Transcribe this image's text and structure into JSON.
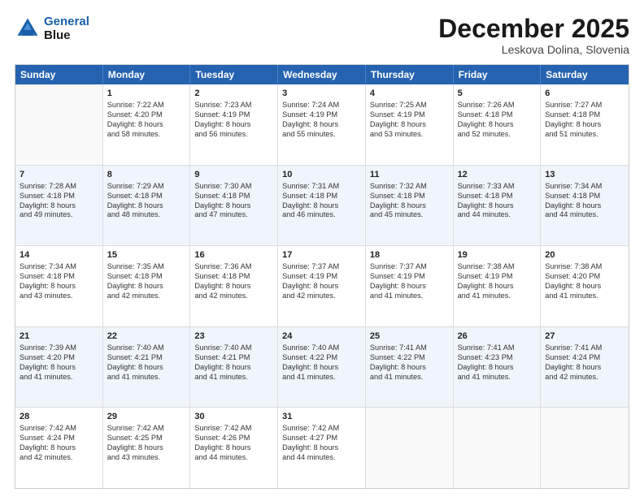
{
  "header": {
    "logo_line1": "General",
    "logo_line2": "Blue",
    "month": "December 2025",
    "location": "Leskova Dolina, Slovenia"
  },
  "days_of_week": [
    "Sunday",
    "Monday",
    "Tuesday",
    "Wednesday",
    "Thursday",
    "Friday",
    "Saturday"
  ],
  "rows": [
    [
      {
        "day": "",
        "sunrise": "",
        "sunset": "",
        "daylight": "",
        "empty": true
      },
      {
        "day": "1",
        "sunrise": "Sunrise: 7:22 AM",
        "sunset": "Sunset: 4:20 PM",
        "daylight": "Daylight: 8 hours",
        "daylight2": "and 58 minutes."
      },
      {
        "day": "2",
        "sunrise": "Sunrise: 7:23 AM",
        "sunset": "Sunset: 4:19 PM",
        "daylight": "Daylight: 8 hours",
        "daylight2": "and 56 minutes."
      },
      {
        "day": "3",
        "sunrise": "Sunrise: 7:24 AM",
        "sunset": "Sunset: 4:19 PM",
        "daylight": "Daylight: 8 hours",
        "daylight2": "and 55 minutes."
      },
      {
        "day": "4",
        "sunrise": "Sunrise: 7:25 AM",
        "sunset": "Sunset: 4:19 PM",
        "daylight": "Daylight: 8 hours",
        "daylight2": "and 53 minutes."
      },
      {
        "day": "5",
        "sunrise": "Sunrise: 7:26 AM",
        "sunset": "Sunset: 4:18 PM",
        "daylight": "Daylight: 8 hours",
        "daylight2": "and 52 minutes."
      },
      {
        "day": "6",
        "sunrise": "Sunrise: 7:27 AM",
        "sunset": "Sunset: 4:18 PM",
        "daylight": "Daylight: 8 hours",
        "daylight2": "and 51 minutes."
      }
    ],
    [
      {
        "day": "7",
        "sunrise": "Sunrise: 7:28 AM",
        "sunset": "Sunset: 4:18 PM",
        "daylight": "Daylight: 8 hours",
        "daylight2": "and 49 minutes."
      },
      {
        "day": "8",
        "sunrise": "Sunrise: 7:29 AM",
        "sunset": "Sunset: 4:18 PM",
        "daylight": "Daylight: 8 hours",
        "daylight2": "and 48 minutes."
      },
      {
        "day": "9",
        "sunrise": "Sunrise: 7:30 AM",
        "sunset": "Sunset: 4:18 PM",
        "daylight": "Daylight: 8 hours",
        "daylight2": "and 47 minutes."
      },
      {
        "day": "10",
        "sunrise": "Sunrise: 7:31 AM",
        "sunset": "Sunset: 4:18 PM",
        "daylight": "Daylight: 8 hours",
        "daylight2": "and 46 minutes."
      },
      {
        "day": "11",
        "sunrise": "Sunrise: 7:32 AM",
        "sunset": "Sunset: 4:18 PM",
        "daylight": "Daylight: 8 hours",
        "daylight2": "and 45 minutes."
      },
      {
        "day": "12",
        "sunrise": "Sunrise: 7:33 AM",
        "sunset": "Sunset: 4:18 PM",
        "daylight": "Daylight: 8 hours",
        "daylight2": "and 44 minutes."
      },
      {
        "day": "13",
        "sunrise": "Sunrise: 7:34 AM",
        "sunset": "Sunset: 4:18 PM",
        "daylight": "Daylight: 8 hours",
        "daylight2": "and 44 minutes."
      }
    ],
    [
      {
        "day": "14",
        "sunrise": "Sunrise: 7:34 AM",
        "sunset": "Sunset: 4:18 PM",
        "daylight": "Daylight: 8 hours",
        "daylight2": "and 43 minutes."
      },
      {
        "day": "15",
        "sunrise": "Sunrise: 7:35 AM",
        "sunset": "Sunset: 4:18 PM",
        "daylight": "Daylight: 8 hours",
        "daylight2": "and 42 minutes."
      },
      {
        "day": "16",
        "sunrise": "Sunrise: 7:36 AM",
        "sunset": "Sunset: 4:18 PM",
        "daylight": "Daylight: 8 hours",
        "daylight2": "and 42 minutes."
      },
      {
        "day": "17",
        "sunrise": "Sunrise: 7:37 AM",
        "sunset": "Sunset: 4:19 PM",
        "daylight": "Daylight: 8 hours",
        "daylight2": "and 42 minutes."
      },
      {
        "day": "18",
        "sunrise": "Sunrise: 7:37 AM",
        "sunset": "Sunset: 4:19 PM",
        "daylight": "Daylight: 8 hours",
        "daylight2": "and 41 minutes."
      },
      {
        "day": "19",
        "sunrise": "Sunrise: 7:38 AM",
        "sunset": "Sunset: 4:19 PM",
        "daylight": "Daylight: 8 hours",
        "daylight2": "and 41 minutes."
      },
      {
        "day": "20",
        "sunrise": "Sunrise: 7:38 AM",
        "sunset": "Sunset: 4:20 PM",
        "daylight": "Daylight: 8 hours",
        "daylight2": "and 41 minutes."
      }
    ],
    [
      {
        "day": "21",
        "sunrise": "Sunrise: 7:39 AM",
        "sunset": "Sunset: 4:20 PM",
        "daylight": "Daylight: 8 hours",
        "daylight2": "and 41 minutes."
      },
      {
        "day": "22",
        "sunrise": "Sunrise: 7:40 AM",
        "sunset": "Sunset: 4:21 PM",
        "daylight": "Daylight: 8 hours",
        "daylight2": "and 41 minutes."
      },
      {
        "day": "23",
        "sunrise": "Sunrise: 7:40 AM",
        "sunset": "Sunset: 4:21 PM",
        "daylight": "Daylight: 8 hours",
        "daylight2": "and 41 minutes."
      },
      {
        "day": "24",
        "sunrise": "Sunrise: 7:40 AM",
        "sunset": "Sunset: 4:22 PM",
        "daylight": "Daylight: 8 hours",
        "daylight2": "and 41 minutes."
      },
      {
        "day": "25",
        "sunrise": "Sunrise: 7:41 AM",
        "sunset": "Sunset: 4:22 PM",
        "daylight": "Daylight: 8 hours",
        "daylight2": "and 41 minutes."
      },
      {
        "day": "26",
        "sunrise": "Sunrise: 7:41 AM",
        "sunset": "Sunset: 4:23 PM",
        "daylight": "Daylight: 8 hours",
        "daylight2": "and 41 minutes."
      },
      {
        "day": "27",
        "sunrise": "Sunrise: 7:41 AM",
        "sunset": "Sunset: 4:24 PM",
        "daylight": "Daylight: 8 hours",
        "daylight2": "and 42 minutes."
      }
    ],
    [
      {
        "day": "28",
        "sunrise": "Sunrise: 7:42 AM",
        "sunset": "Sunset: 4:24 PM",
        "daylight": "Daylight: 8 hours",
        "daylight2": "and 42 minutes."
      },
      {
        "day": "29",
        "sunrise": "Sunrise: 7:42 AM",
        "sunset": "Sunset: 4:25 PM",
        "daylight": "Daylight: 8 hours",
        "daylight2": "and 43 minutes."
      },
      {
        "day": "30",
        "sunrise": "Sunrise: 7:42 AM",
        "sunset": "Sunset: 4:26 PM",
        "daylight": "Daylight: 8 hours",
        "daylight2": "and 44 minutes."
      },
      {
        "day": "31",
        "sunrise": "Sunrise: 7:42 AM",
        "sunset": "Sunset: 4:27 PM",
        "daylight": "Daylight: 8 hours",
        "daylight2": "and 44 minutes."
      },
      {
        "day": "",
        "sunrise": "",
        "sunset": "",
        "daylight": "",
        "daylight2": "",
        "empty": true
      },
      {
        "day": "",
        "sunrise": "",
        "sunset": "",
        "daylight": "",
        "daylight2": "",
        "empty": true
      },
      {
        "day": "",
        "sunrise": "",
        "sunset": "",
        "daylight": "",
        "daylight2": "",
        "empty": true
      }
    ]
  ]
}
